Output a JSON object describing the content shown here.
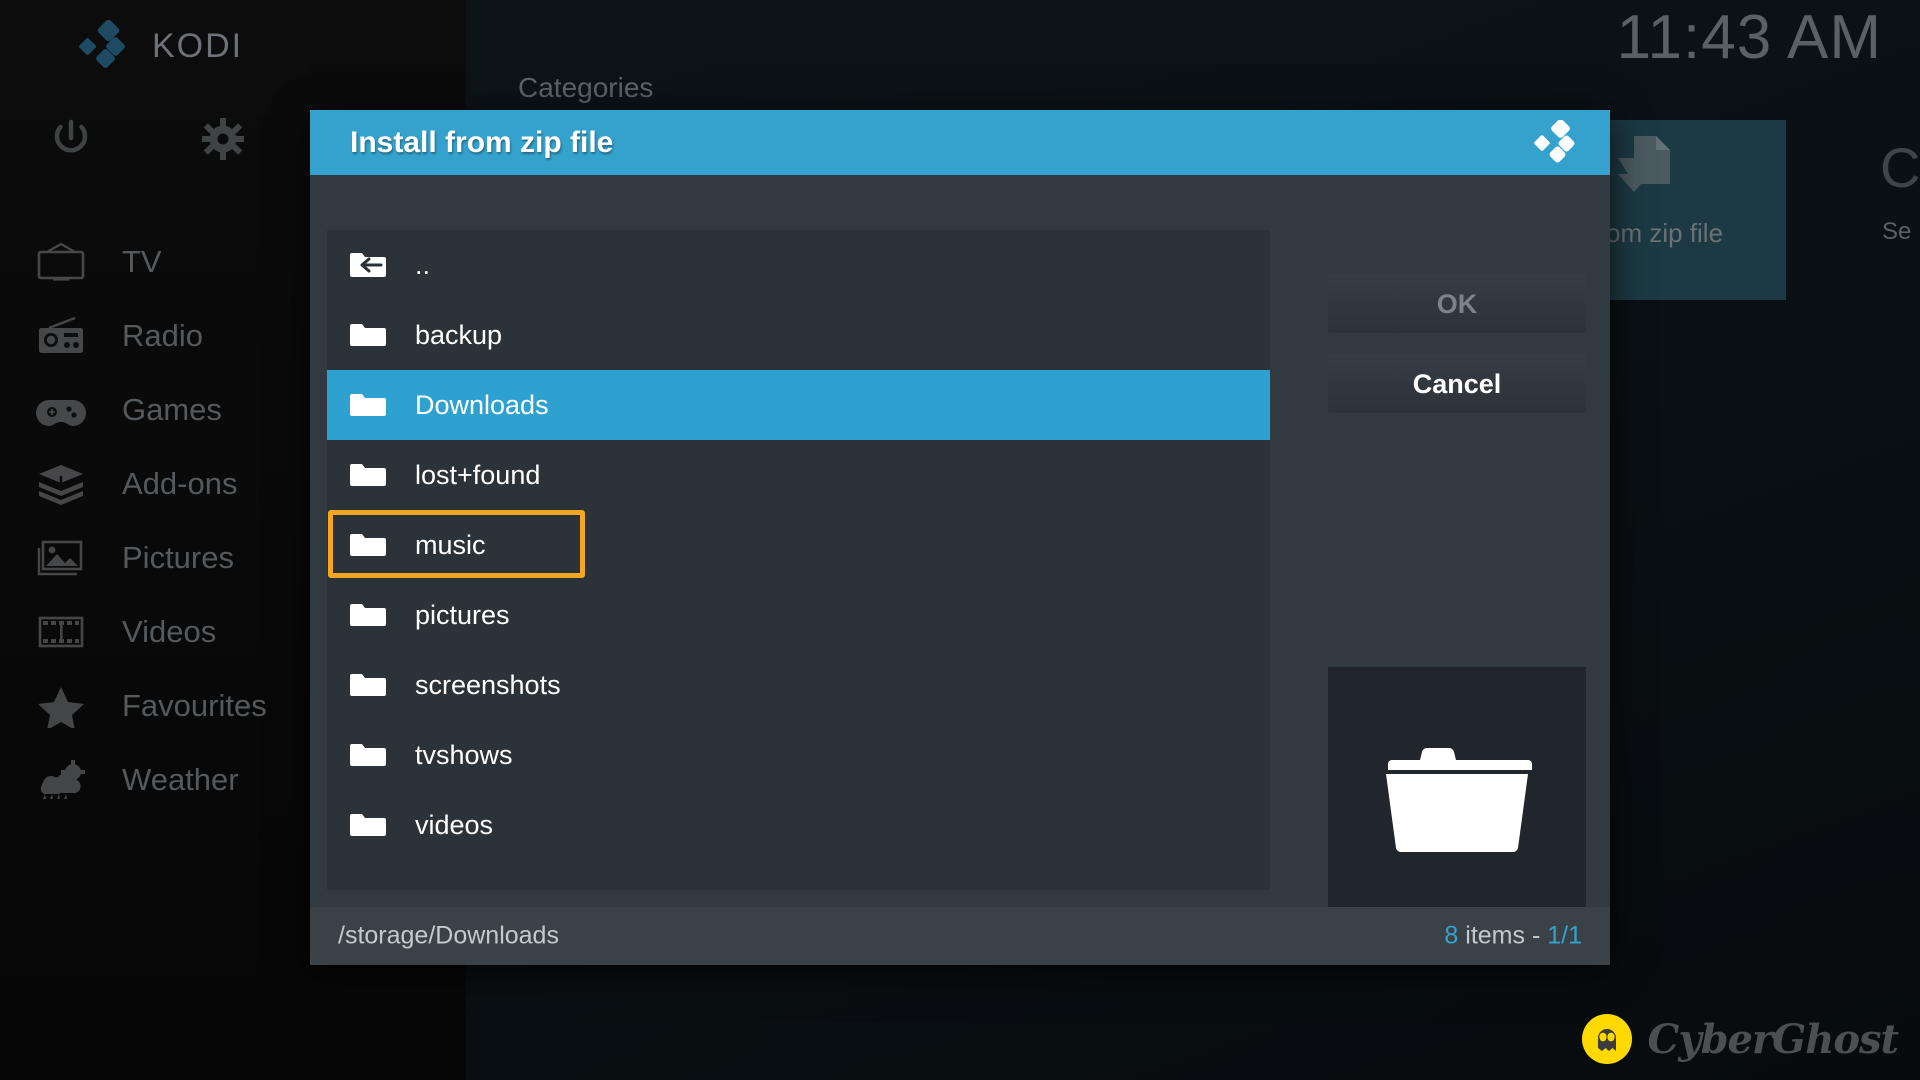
{
  "app": {
    "brand": "KODI",
    "clock": "11:43 AM",
    "brand_logo_icon": "kodi-logo-icon"
  },
  "background": {
    "categories_label": "Categories",
    "power_icon": "power-icon",
    "settings_icon": "gear-icon",
    "menu": [
      {
        "label": "TV",
        "icon": "tv-icon"
      },
      {
        "label": "Radio",
        "icon": "radio-icon"
      },
      {
        "label": "Games",
        "icon": "gamepad-icon"
      },
      {
        "label": "Add-ons",
        "icon": "addons-box-icon"
      },
      {
        "label": "Pictures",
        "icon": "pictures-icon"
      },
      {
        "label": "Videos",
        "icon": "filmstrip-icon"
      },
      {
        "label": "Favourites",
        "icon": "star-icon"
      },
      {
        "label": "Weather",
        "icon": "weather-cloud-rain-icon"
      }
    ],
    "tile": {
      "label": "om zip file",
      "icon": "file-download-icon"
    },
    "tile_right": {
      "glyph": "C",
      "label": "Se"
    }
  },
  "dialog": {
    "title": "Install from zip file",
    "header_icon": "kodi-logo-icon",
    "accent_color": "#35a2cd",
    "highlight_color": "#f5a623",
    "buttons": {
      "ok": "OK",
      "cancel": "Cancel"
    },
    "preview_icon": "folder-icon",
    "items": [
      {
        "name": "..",
        "icon": "folder-up-icon",
        "selected": false
      },
      {
        "name": "backup",
        "icon": "folder-icon",
        "selected": false
      },
      {
        "name": "Downloads",
        "icon": "folder-icon",
        "selected": true
      },
      {
        "name": "lost+found",
        "icon": "folder-icon",
        "selected": false
      },
      {
        "name": "music",
        "icon": "folder-icon",
        "selected": false
      },
      {
        "name": "pictures",
        "icon": "folder-icon",
        "selected": false
      },
      {
        "name": "screenshots",
        "icon": "folder-icon",
        "selected": false
      },
      {
        "name": "tvshows",
        "icon": "folder-icon",
        "selected": false
      },
      {
        "name": "videos",
        "icon": "folder-icon",
        "selected": false
      }
    ],
    "footer": {
      "path": "/storage/Downloads",
      "count_number": "8",
      "count_label": " items - ",
      "page": "1/1"
    }
  },
  "watermark": {
    "text": "CyberGhost",
    "icon": "cyberghost-mascot-icon"
  }
}
